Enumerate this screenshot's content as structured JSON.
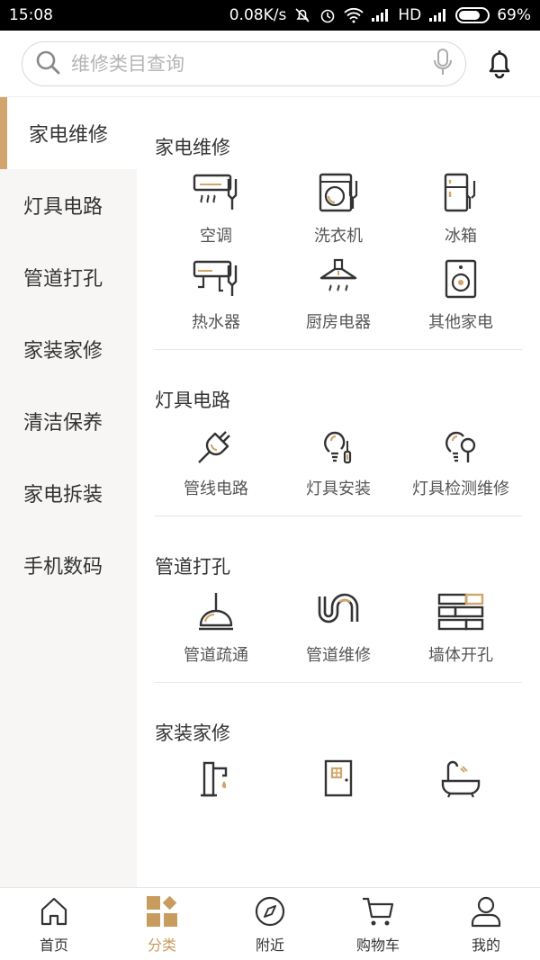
{
  "status_bar": {
    "time": "15:08",
    "network_speed": "0.08K/s",
    "network_type": "HD",
    "battery": "69%"
  },
  "header": {
    "search_placeholder": "维修类目查询"
  },
  "sidebar": {
    "items": [
      {
        "label": "家电维修",
        "active": true
      },
      {
        "label": "灯具电路"
      },
      {
        "label": "管道打孔"
      },
      {
        "label": "家装家修"
      },
      {
        "label": "清洁保养"
      },
      {
        "label": "家电拆装"
      },
      {
        "label": "手机数码"
      }
    ]
  },
  "content": {
    "sections": [
      {
        "title": "家电维修",
        "items": [
          {
            "label": "空调",
            "icon": "air-conditioner-repair-icon"
          },
          {
            "label": "洗衣机",
            "icon": "washing-machine-repair-icon"
          },
          {
            "label": "冰箱",
            "icon": "fridge-repair-icon"
          },
          {
            "label": "热水器",
            "icon": "water-heater-repair-icon"
          },
          {
            "label": "厨房电器",
            "icon": "range-hood-icon"
          },
          {
            "label": "其他家电",
            "icon": "speaker-icon"
          }
        ]
      },
      {
        "title": "灯具电路",
        "items": [
          {
            "label": "管线电路",
            "icon": "plug-icon"
          },
          {
            "label": "灯具安装",
            "icon": "bulb-screwdriver-icon"
          },
          {
            "label": "灯具检测维修",
            "icon": "bulb-magnifier-icon"
          }
        ]
      },
      {
        "title": "管道打孔",
        "items": [
          {
            "label": "管道疏通",
            "icon": "plunger-icon"
          },
          {
            "label": "管道维修",
            "icon": "pipe-icon"
          },
          {
            "label": "墙体开孔",
            "icon": "brick-wall-icon"
          }
        ]
      },
      {
        "title": "家装家修",
        "items": [
          {
            "label": "",
            "icon": "faucet-icon"
          },
          {
            "label": "",
            "icon": "door-icon"
          },
          {
            "label": "",
            "icon": "bathtub-icon"
          }
        ]
      }
    ]
  },
  "tabbar": {
    "tabs": [
      {
        "label": "首页",
        "icon": "home-icon"
      },
      {
        "label": "分类",
        "icon": "category-icon",
        "active": true
      },
      {
        "label": "附近",
        "icon": "compass-icon"
      },
      {
        "label": "购物车",
        "icon": "cart-icon"
      },
      {
        "label": "我的",
        "icon": "user-icon"
      }
    ]
  },
  "colors": {
    "accent": "#c89b5e",
    "sidebar_bg": "#f7f6f5",
    "text": "#333333"
  }
}
